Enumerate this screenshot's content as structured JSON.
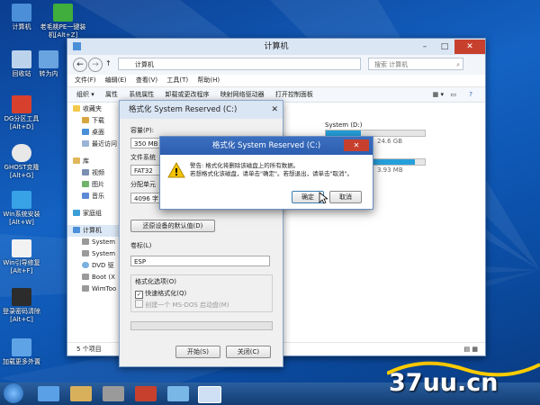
{
  "desktop_icons": [
    {
      "label": "计算机"
    },
    {
      "label": "老毛桃PE一键装机[Alt+Z]"
    },
    {
      "label": "回收站"
    },
    {
      "label": "转为内"
    },
    {
      "label": "DG分区工具[Alt+D]"
    },
    {
      "label": "GHOST克隆[Alt+G]"
    },
    {
      "label": "Win系统安装[Alt+W]"
    },
    {
      "label": "Win引导修复[Alt+F]"
    },
    {
      "label": "登录密码清除[Alt+C]"
    },
    {
      "label": "加载更多外置"
    }
  ],
  "explorer": {
    "title": "计算机",
    "path": "计算机",
    "search_placeholder": "搜索 计算机",
    "menu": [
      "文件(F)",
      "编辑(E)",
      "查看(V)",
      "工具(T)",
      "帮助(H)"
    ],
    "toolbar": [
      "组织 ▾",
      "属性",
      "系统属性",
      "卸载或更改程序",
      "映射网络驱动器",
      "打开控制面板"
    ],
    "nav": [
      "收藏夹",
      "下载",
      "桌面",
      "最近访问",
      "库",
      "视频",
      "图片",
      "音乐",
      "家庭组",
      "计算机",
      "System",
      "System",
      "DVD 驱",
      "Boot (X",
      "WimToo"
    ],
    "drives": [
      {
        "name": "System (D:)",
        "info": "24.6 GB",
        "fill": 0.35
      },
      {
        "name": "",
        "info": "3.93 MB",
        "fill": 0.9
      }
    ],
    "status": "5 个项目"
  },
  "format_dialog": {
    "title": "格式化 System Reserved (C:)",
    "capacity_label": "容量(P):",
    "capacity_value": "350 MB",
    "fs_label": "文件系统",
    "fs_value": "FAT32",
    "alloc_label": "分配单元",
    "alloc_value": "4096 字",
    "restore_defaults": "还原设备的默认值(D)",
    "volume_label": "卷标(L)",
    "volume_value": "ESP",
    "options_label": "格式化选项(O)",
    "quick_format": "快速格式化(Q)",
    "msdos": "创建一个 MS-DOS 启动盘(M)",
    "start": "开始(S)",
    "close": "关闭(C)"
  },
  "warning_dialog": {
    "title": "格式化 System Reserved (C:)",
    "line1": "警告: 格式化将删除该磁盘上的所有数据。",
    "line2": "若想格式化该磁盘，请单击\"确定\"。若想退出，请单击\"取消\"。",
    "ok": "确定",
    "cancel": "取消"
  },
  "watermark": "37uu.cn",
  "colors": {
    "accent": "#2d5eaf",
    "close": "#c7402e",
    "drive_bar": "#26a0da"
  }
}
